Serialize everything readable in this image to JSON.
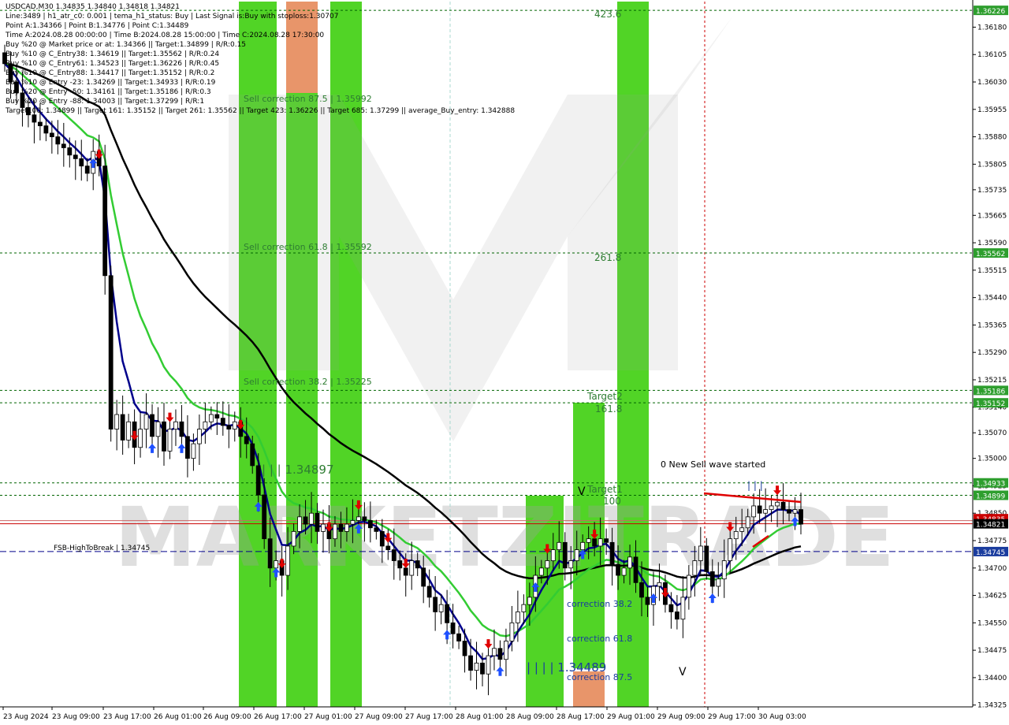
{
  "window": {
    "title": "USDCAD,M30",
    "ohlc": "1.34835 1.34840 1.34818 1.34821"
  },
  "info_lines": [
    "Line:3489 | h1_atr_c0: 0.001 | tema_h1_status: Buy | Last Signal is:Buy with stoploss:1.30707",
    "Point A:1.34366 | Point B:1.34776 | Point C:1.34489",
    "Time A:2024.08.28 00:00:00 | Time B:2024.08.28 15:00:00 | Time C:2024.08.28 17:30:00",
    "Buy %20 @ Market price or at: 1.34366 || Target:1.34899 | R/R:0.15",
    "Buy %10 @ C_Entry38: 1.34619 || Target:1.35562 | R/R:0.24",
    "Buy %10 @ C_Entry61: 1.34523 || Target:1.36226 | R/R:0.45",
    "Buy %10 @ C_Entry88: 1.34417 || Target:1.35152 | R/R:0.2",
    "Buy %10 @ Entry -23: 1.34269 || Target:1.34933 | R/R:0.19",
    "Buy %20 @ Entry -50: 1.34161 || Target:1.35186 | R/R:0.3",
    "Buy %20 @ Entry -88: 1.34003 || Target:1.37299 | R/R:1",
    "Target100: 1.34899 || Target 161: 1.35152 || Target 261: 1.35562 || Target 423: 1.36226 || Target 685: 1.37299 || average_Buy_entry: 1.342888"
  ],
  "watermark": "MARKETZITRADE",
  "colors": {
    "bull_bar": "#000000",
    "green_zone": "#33cc00",
    "orange_zone": "#e8956a",
    "ema_fast": "#00008b",
    "ema_mid": "#33cc33",
    "ema_slow": "#000000",
    "level_green": "#006400",
    "current_price": "#cc0000",
    "hightobreak": "#00008b",
    "buy_arrow": "#1e50ff",
    "sell_arrow": "#e00000"
  },
  "chart_data": {
    "type": "candlestick",
    "symbol": "USDCAD",
    "timeframe": "M30",
    "ylim": [
      1.3432,
      1.3625
    ],
    "y_ticks": [
      "1.36180",
      "1.36105",
      "1.36030",
      "1.35955",
      "1.35880",
      "1.35805",
      "1.35735",
      "1.35665",
      "1.35590",
      "1.35515",
      "1.35440",
      "1.35365",
      "1.35290",
      "1.35215",
      "1.35140",
      "1.35070",
      "1.35000",
      "1.34925",
      "1.34850",
      "1.34775",
      "1.34700",
      "1.34625",
      "1.34550",
      "1.34475",
      "1.34400",
      "1.34325"
    ],
    "x_ticks": [
      "23 Aug 2024",
      "23 Aug 09:00",
      "23 Aug 17:00",
      "26 Aug 01:00",
      "26 Aug 09:00",
      "26 Aug 17:00",
      "27 Aug 01:00",
      "27 Aug 09:00",
      "27 Aug 17:00",
      "28 Aug 01:00",
      "28 Aug 09:00",
      "28 Aug 17:00",
      "29 Aug 01:00",
      "29 Aug 09:00",
      "29 Aug 17:00",
      "30 Aug 03:00"
    ],
    "price_levels": [
      {
        "value": 1.36226,
        "label": "1.36226"
      },
      {
        "value": 1.35562,
        "label": "1.35562"
      },
      {
        "value": 1.35186,
        "label": "1.35186"
      },
      {
        "value": 1.35152,
        "label": "1.35152"
      },
      {
        "value": 1.34933,
        "label": "1.34933"
      },
      {
        "value": 1.34899,
        "label": "1.34899"
      }
    ],
    "current_price": {
      "value": 1.34821,
      "label": "1.34821"
    },
    "red_price_tag": {
      "value": 1.34835,
      "label": "1.34835"
    },
    "high_to_break": {
      "value": 1.34745,
      "label": "1.34745",
      "text": "FSB-HighToBreak | 1.34745"
    },
    "annotations": {
      "sell_corr_875": "Sell correction 87.5 | 1.35992",
      "sell_corr_618": "Sell correction 61.8 | 1.35592",
      "sell_corr_382": "Sell correction 38.2 | 1.35225",
      "fib_4236": "423.6",
      "fib_2618": "261.8",
      "fib_1618": "161.8",
      "target2": "Target2",
      "target1": "Target1",
      "fib_100": "100",
      "point_b_text": "| | | 1.34897",
      "point_c_text": "| | | | 1.34489",
      "corr_382": "correction 38.2",
      "corr_618": "correction 61.8",
      "corr_875": "correction 87.5",
      "new_sell_wave": "0 New Sell wave started",
      "bars_marker": "| | |",
      "v_marker": "V",
      "v_marker2": "V"
    },
    "series": [
      {
        "name": "close",
        "values": [
          1.3608,
          1.3603,
          1.36,
          1.3596,
          1.3594,
          1.3592,
          1.3591,
          1.3589,
          1.3588,
          1.3586,
          1.3585,
          1.3583,
          1.3582,
          1.358,
          1.3578,
          1.3584,
          1.358,
          1.355,
          1.3508,
          1.3512,
          1.3505,
          1.351,
          1.3503,
          1.3508,
          1.3512,
          1.3506,
          1.351,
          1.3502,
          1.3508,
          1.351,
          1.3506,
          1.35,
          1.3504,
          1.3508,
          1.351,
          1.3512,
          1.3511,
          1.3509,
          1.3508,
          1.351,
          1.3506,
          1.3504,
          1.3498,
          1.349,
          1.3478,
          1.347,
          1.3472,
          1.3468,
          1.3476,
          1.348,
          1.3484,
          1.3482,
          1.3485,
          1.348,
          1.3482,
          1.3478,
          1.3482,
          1.348,
          1.3482,
          1.3483,
          1.3484,
          1.3483,
          1.3481,
          1.348,
          1.3476,
          1.3475,
          1.3472,
          1.347,
          1.3468,
          1.3472,
          1.347,
          1.3465,
          1.3462,
          1.3458,
          1.346,
          1.3455,
          1.3452,
          1.345,
          1.3446,
          1.3442,
          1.3444,
          1.3441,
          1.3446,
          1.3448,
          1.3445,
          1.345,
          1.3455,
          1.3458,
          1.346,
          1.3462,
          1.3468,
          1.347,
          1.3472,
          1.3475,
          1.3477,
          1.347,
          1.3472,
          1.3475,
          1.3477,
          1.3478,
          1.3476,
          1.3478,
          1.3477,
          1.3471,
          1.3468,
          1.347,
          1.3473,
          1.3466,
          1.3462,
          1.346,
          1.3465,
          1.3466,
          1.346,
          1.3458,
          1.3456,
          1.3462,
          1.3468,
          1.3472,
          1.3476,
          1.3469,
          1.3465,
          1.3467,
          1.3472,
          1.3478,
          1.348,
          1.3481,
          1.3484,
          1.3487,
          1.3485,
          1.3486,
          1.3487,
          1.3488,
          1.3486,
          1.3485,
          1.3486,
          1.3482
        ]
      }
    ]
  }
}
